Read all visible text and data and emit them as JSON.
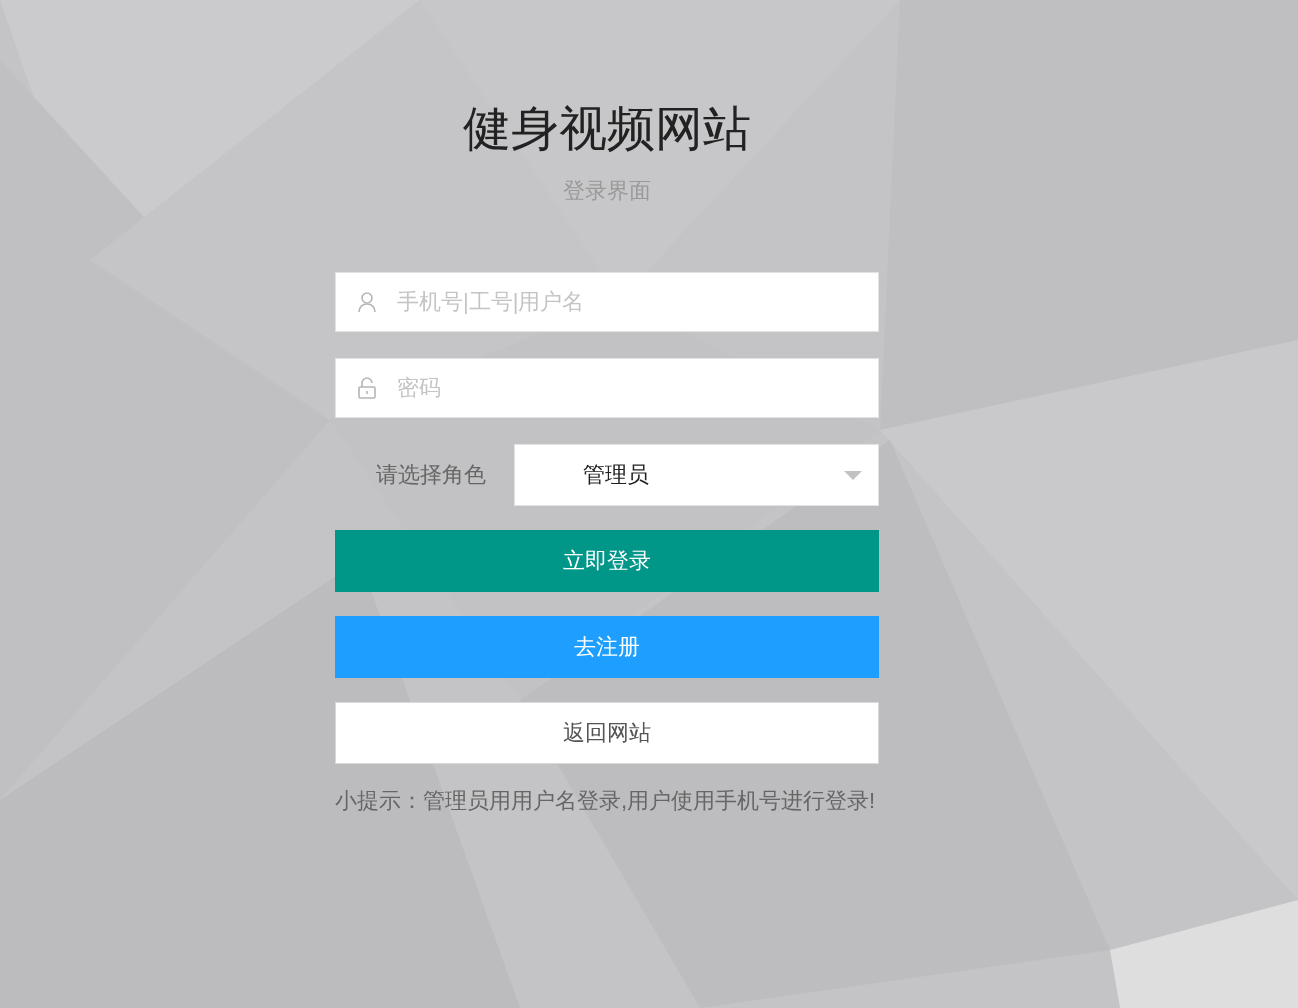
{
  "title": "健身视频网站",
  "subtitle": "登录界面",
  "fields": [
    {
      "kind": "user",
      "placeholder": "手机号|工号|用户名"
    },
    {
      "kind": "password",
      "placeholder": "密码"
    }
  ],
  "role": {
    "label": "请选择角色",
    "value": "管理员"
  },
  "buttons": [
    {
      "kind": "primary",
      "label": "立即登录"
    },
    {
      "kind": "secondary",
      "label": "去注册"
    },
    {
      "kind": "plain",
      "label": "返回网站"
    }
  ],
  "hint": "小提示：管理员用用户名登录,用户使用手机号进行登录!"
}
